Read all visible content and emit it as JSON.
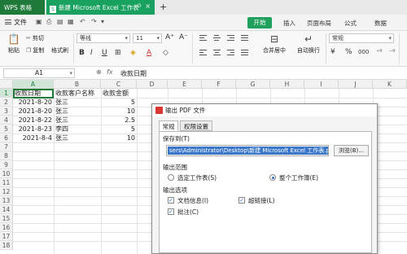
{
  "tabs": {
    "app": "WPS 表格",
    "doc": "新建 Microsoft Excel 工作表",
    "add": "+",
    "close": "×",
    "pin": "⊙"
  },
  "menu": {
    "file": "文件",
    "start": "开始",
    "items": [
      "插入",
      "页面布局",
      "公式",
      "数据"
    ]
  },
  "ribbon": {
    "paste": "粘贴",
    "cut": "剪切",
    "copy": "复制",
    "format_painter": "格式刷",
    "font_name": "等线",
    "font_size": "11",
    "bold": "B",
    "italic": "I",
    "underline": "U",
    "merge_center": "合并居中",
    "wrap": "自动换行",
    "number_format": "常规",
    "currency": "¥",
    "percent": "%",
    "thousands": "000"
  },
  "formula_bar": {
    "cell_ref": "A1",
    "content": "收款日期"
  },
  "sheet": {
    "columns": [
      "A",
      "B",
      "C",
      "D",
      "E",
      "F",
      "G",
      "H",
      "I",
      "J",
      "K"
    ],
    "rows": [
      "1",
      "2",
      "3",
      "4",
      "5",
      "6",
      "7",
      "8",
      "9",
      "10",
      "11",
      "12",
      "13",
      "14",
      "15",
      "16",
      "17",
      "18"
    ],
    "headers": [
      "收款日期",
      "收款客户名称",
      "收款金额"
    ],
    "data": [
      [
        "2021-8-20",
        "张三",
        "5"
      ],
      [
        "2021-8-20",
        "张三",
        "10"
      ],
      [
        "2021-8-22",
        "张三",
        "2.5"
      ],
      [
        "2021-8-23",
        "李四",
        "5"
      ],
      [
        "2021-8-4",
        "张三",
        "10"
      ]
    ]
  },
  "dialog": {
    "title": "输出 PDF 文件",
    "tab_general": "常规",
    "tab_permissions": "权限设置",
    "save_to_label": "保存到(T)",
    "save_path": "sers\\Administrator\\Desktop\\新建 Microsoft Excel 工作表.pdf",
    "browse": "浏览(B)...",
    "range_label": "输出范围",
    "range_selected": "选定工作表(S)",
    "range_whole": "整个工作簿(E)",
    "options_label": "输出选项",
    "opt_docinfo": "文档信息(I)",
    "opt_hyperlink": "超链接(L)",
    "opt_comments": "批注(C)"
  }
}
